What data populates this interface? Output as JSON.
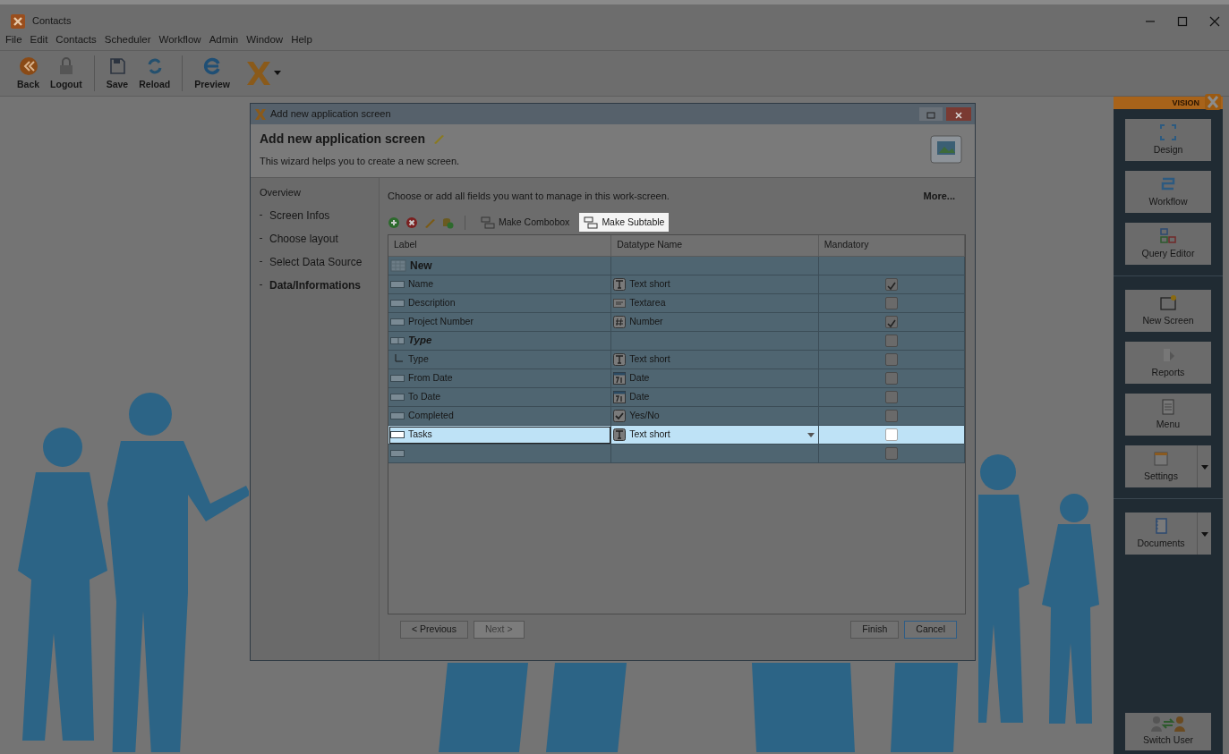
{
  "window": {
    "title": "Contacts"
  },
  "menu": [
    "File",
    "Edit",
    "Contacts",
    "Scheduler",
    "Workflow",
    "Admin",
    "Window",
    "Help"
  ],
  "toolbar": [
    {
      "label": "Back",
      "kind": "back"
    },
    {
      "label": "Logout",
      "kind": "logout"
    },
    {
      "label": "Save",
      "kind": "save"
    },
    {
      "label": "Reload",
      "kind": "reload"
    },
    {
      "label": "Preview",
      "kind": "preview"
    }
  ],
  "dialog": {
    "title": "Add new application screen",
    "heading": "Add new application screen",
    "subtitle": "This wizard helps you to create a new screen.",
    "steps_title": "Overview",
    "steps": [
      {
        "label": "Screen Infos",
        "selected": false
      },
      {
        "label": "Choose layout",
        "selected": false
      },
      {
        "label": "Select Data Source",
        "selected": false
      },
      {
        "label": "Data/Informations",
        "selected": true
      }
    ],
    "instruction": "Choose or add all fields you want to manage in this work-screen.",
    "more_link": "More...",
    "actions": [
      {
        "label": "Make Combobox",
        "highlighted": false
      },
      {
        "label": "Make Subtable",
        "highlighted": true
      }
    ],
    "table": {
      "columns": [
        "Label",
        "Datatype Name",
        "Mandatory"
      ],
      "rows": [
        {
          "kind": "group",
          "label": "New",
          "selected": false
        },
        {
          "kind": "field",
          "label": "Name",
          "datatype": {
            "label": "Text short",
            "kind": "text"
          },
          "mandatory": true,
          "selected": false
        },
        {
          "kind": "field",
          "label": "Description",
          "datatype": {
            "label": "Textarea",
            "kind": "textarea"
          },
          "mandatory": false,
          "selected": false
        },
        {
          "kind": "field",
          "label": "Project Number",
          "datatype": {
            "label": "Number",
            "kind": "number"
          },
          "mandatory": true,
          "selected": false
        },
        {
          "kind": "subgroup",
          "label": "Type",
          "mandatory": false,
          "selected": false
        },
        {
          "kind": "child",
          "label": "Type",
          "datatype": {
            "label": "Text short",
            "kind": "text"
          },
          "mandatory": false,
          "selected": false
        },
        {
          "kind": "field",
          "label": "From Date",
          "datatype": {
            "label": "Date",
            "kind": "date"
          },
          "mandatory": false,
          "selected": false
        },
        {
          "kind": "field",
          "label": "To Date",
          "datatype": {
            "label": "Date",
            "kind": "date"
          },
          "mandatory": false,
          "selected": false
        },
        {
          "kind": "field",
          "label": "Completed",
          "datatype": {
            "label": "Yes/No",
            "kind": "yesno"
          },
          "mandatory": false,
          "selected": false
        },
        {
          "kind": "field",
          "label": "Tasks",
          "datatype": {
            "label": "Text short",
            "kind": "text"
          },
          "mandatory": false,
          "selected": true
        },
        {
          "kind": "empty",
          "mandatory": false,
          "selected": false
        }
      ]
    },
    "buttons": [
      {
        "label": "< Previous",
        "disabled": false,
        "default": false
      },
      {
        "label": "Next >",
        "disabled": true,
        "default": false
      },
      {
        "label": "Finish",
        "disabled": false,
        "default": false
      },
      {
        "label": "Cancel",
        "disabled": false,
        "default": true
      }
    ]
  },
  "sidebar": {
    "brand": "VISION",
    "sections": [
      {
        "items": [
          {
            "label": "Design",
            "kind": "design",
            "dropdown": false
          },
          {
            "label": "Workflow",
            "kind": "workflow",
            "dropdown": false
          },
          {
            "label": "Query Editor",
            "kind": "query",
            "dropdown": false
          }
        ]
      },
      {
        "items": [
          {
            "label": "New Screen",
            "kind": "newscreen",
            "dropdown": false
          },
          {
            "label": "Reports",
            "kind": "reports",
            "dropdown": false
          },
          {
            "label": "Menu",
            "kind": "menu",
            "dropdown": false
          },
          {
            "label": "Settings",
            "kind": "settings",
            "dropdown": true
          }
        ]
      },
      {
        "items": [
          {
            "label": "Documents",
            "kind": "documents",
            "dropdown": true
          }
        ]
      }
    ],
    "footer": {
      "label": "Switch User"
    }
  }
}
